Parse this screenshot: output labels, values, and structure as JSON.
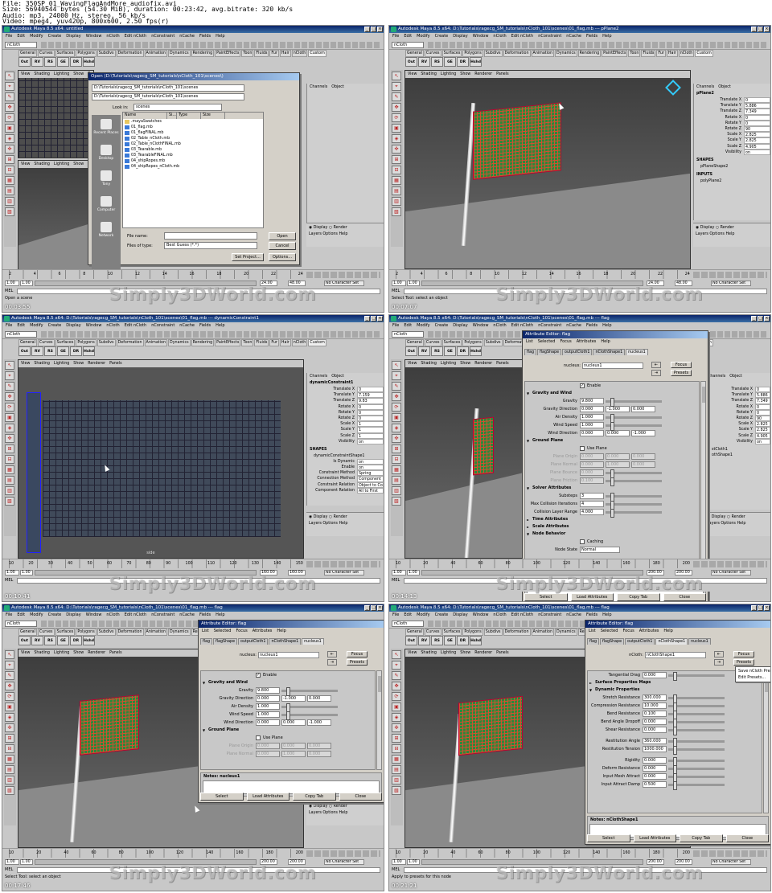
{
  "info": {
    "line1": "File: 350SP_01_WavingFlagAndMore_audiofix.avi",
    "line2": "Size: 56940544 bytes (54.30 MiB), duration: 00:23:42, avg.bitrate: 320 kb/s",
    "line3": "Audio: mp3, 24000 Hz, stereo, 56 kb/s",
    "line4": "Video: mpeg4, yuv420p, 800x600, 2.50 fps(r)"
  },
  "watermark": "Simply3DWorld.com",
  "common": {
    "menus": [
      "File",
      "Edit",
      "Modify",
      "Create",
      "Display",
      "Window",
      "nCloth",
      "Edit nCloth",
      "nConstraint",
      "nCache",
      "Fields",
      "Help"
    ],
    "mode": "nCloth",
    "shelf_tabs": [
      "General",
      "Curves",
      "Surfaces",
      "Polygons",
      "Subdivs",
      "Deformation",
      "Animation",
      "Dynamics",
      "Rendering",
      "PaintEffects",
      "Toon",
      "Fluids",
      "Fur",
      "Hair",
      "nCloth",
      "Custom"
    ],
    "shelf_icons": [
      "Out",
      "RV",
      "RS",
      "GE",
      "DR",
      "Hshd"
    ],
    "vp_menus": [
      "View",
      "Shading",
      "Lighting",
      "Show",
      "Renderer",
      "Panels"
    ],
    "mel": "MEL",
    "channel_head": [
      "Channels",
      "Object"
    ],
    "layer_radio": [
      "Display",
      "Render"
    ],
    "layer_menu": [
      "Layers",
      "Options",
      "Help"
    ],
    "no_char_set": "No Character Set",
    "tick_labels": [
      "2",
      "4",
      "6",
      "8",
      "10",
      "12",
      "14",
      "16",
      "18",
      "20",
      "22",
      "24"
    ],
    "tick_labels_long": [
      "10",
      "20",
      "30",
      "40",
      "50",
      "60",
      "70",
      "80",
      "90",
      "100",
      "110",
      "120",
      "130",
      "140",
      "150"
    ],
    "tick_labels_long2": [
      "10",
      "20",
      "40",
      "60",
      "80",
      "100",
      "120",
      "140",
      "160",
      "180",
      "200"
    ],
    "toolbox": [
      "↖",
      "⌖",
      "✎",
      "✥",
      "⟳",
      "▣",
      "◈",
      "✜",
      "⊞",
      "⊟",
      "▦",
      "▤",
      "▥",
      "▧"
    ]
  },
  "frames": {
    "f1": {
      "title": "Autodesk Maya 8.5 x64: untitled",
      "range_start": "1.00",
      "range_start2": "1.00",
      "range_end": "24.00",
      "range_end2": "48.00",
      "help": "Open a scene",
      "vp_label": "front",
      "dialog": {
        "title": "Open (D:\\Tutorials\\ragecg_SM_tutorials\\nCloth_101\\scenes\\)",
        "path1": "D:\\Tutorials\\ragecg_SM_tutorials\\nCloth_101\\scenes",
        "path2": "D:\\Tutorials\\ragecg_SM_tutorials\\nCloth_101\\scenes",
        "look_in_label": "Look in:",
        "look_in": "scenes",
        "cols": [
          "Name",
          "Si...",
          "Type",
          "Size"
        ],
        "files": [
          ".mayaSwatches",
          "01_flag.mb",
          "01_flagFINAL.mb",
          "02_Table_nCloth.mb",
          "02_Table_nClothFINAL.mb",
          "03_Tearable.mb",
          "03_TearableFINAL.mb",
          "04_shipRopes.mb",
          "04_shipRopes_nCloth.mb"
        ],
        "places": [
          "Recent Places",
          "Desktop",
          "Tony",
          "Computer",
          "Network"
        ],
        "file_name_label": "File name:",
        "files_type_label": "Files of type:",
        "files_type": "Best Guess (*.*)",
        "open": "Open",
        "cancel": "Cancel",
        "set_project": "Set Project...",
        "options": "Options..."
      }
    },
    "f2": {
      "title": "Autodesk Maya 8.5 x64: D:\\Tutorials\\ragecg_SM_tutorials\\nCloth_101\\scenes\\01_flag.mb --- pPlane2",
      "obj": "pPlane2",
      "channels": [
        {
          "k": "Translate X",
          "v": "0"
        },
        {
          "k": "Translate Y",
          "v": "5.886"
        },
        {
          "k": "Translate Z",
          "v": "7.349"
        },
        {
          "k": "Rotate X",
          "v": "0"
        },
        {
          "k": "Rotate Y",
          "v": "0"
        },
        {
          "k": "Rotate Z",
          "v": "90"
        },
        {
          "k": "Scale X",
          "v": "2.825"
        },
        {
          "k": "Scale Y",
          "v": "2.825"
        },
        {
          "k": "Scale Z",
          "v": "4.905"
        },
        {
          "k": "Visibility",
          "v": "on"
        }
      ],
      "shapes": "SHAPES",
      "shape": "pPlaneShape2",
      "inputs": "INPUTS",
      "input": "polyPlane2",
      "vp_label": "persp",
      "range_start": "1.00",
      "range_start2": "1.00",
      "range_end": "24.00",
      "range_end2": "48.00",
      "help": "Select Tool: select an object"
    },
    "f3": {
      "title": "Autodesk Maya 8.5 x64: D:\\Tutorials\\ragecg_SM_tutorials\\nCloth_101\\scenes\\01_flag.mb --- dynamicConstraint1",
      "obj": "dynamicConstraint1",
      "channels": [
        {
          "k": "Translate X",
          "v": "0"
        },
        {
          "k": "Translate Y",
          "v": "7.159"
        },
        {
          "k": "Translate Z",
          "v": "9.83"
        },
        {
          "k": "Rotate X",
          "v": "0"
        },
        {
          "k": "Rotate Y",
          "v": "0"
        },
        {
          "k": "Rotate Z",
          "v": "0"
        },
        {
          "k": "Scale X",
          "v": "1"
        },
        {
          "k": "Scale Y",
          "v": "1"
        },
        {
          "k": "Scale Z",
          "v": "1"
        },
        {
          "k": "Visibility",
          "v": "on"
        }
      ],
      "shapes": "SHAPES",
      "shape": "dynamicConstraintShape1",
      "shape_channels": [
        {
          "k": "Is Dynamic",
          "v": "on"
        },
        {
          "k": "Enable",
          "v": "on"
        },
        {
          "k": "Constraint Method",
          "v": "Spring"
        },
        {
          "k": "Connection Method",
          "v": "Component"
        },
        {
          "k": "Constraint Relation",
          "v": "Object to Co"
        },
        {
          "k": "Component Relation",
          "v": "All to First"
        }
      ],
      "vp_label": "side",
      "range_start": "1.00",
      "range_start2": "1.00",
      "range_end": "160.00",
      "range_end2": "160.00",
      "help": ""
    },
    "f4": {
      "title": "Autodesk Maya 8.5 x64: D:\\Tutorials\\ragecg_SM_tutorials\\nCloth_101\\scenes\\01_flag.mb --- flag",
      "ae": {
        "title": "Attribute Editor: flag",
        "menus": [
          "List",
          "Selected",
          "Focus",
          "Attributes",
          "Help"
        ],
        "tabs": [
          "flag",
          "flagShape",
          "outputCloth1",
          "nClothShape1",
          "nucleus1"
        ],
        "node_label": "nucleus:",
        "node": "nucleus1",
        "focus": "Focus",
        "presets": "Presets",
        "enable": "Enable",
        "gw": "Gravity and Wind",
        "gravity_k": "Gravity",
        "gravity": "9.800",
        "gdir_k": "Gravity Direction",
        "gdir": [
          "0.000",
          "-1.000",
          "0.000"
        ],
        "air_k": "Air Density",
        "air": "1.000",
        "wspeed_k": "Wind Speed",
        "wspeed": "1.000",
        "wdir_k": "Wind Direction",
        "wdir": [
          "0.000",
          "0.000",
          "-1.000"
        ],
        "gp": "Ground Plane",
        "use_plane": "Use Plane",
        "porigin_k": "Plane Origin",
        "porigin": [
          "0.000",
          "0.000",
          "0.000"
        ],
        "pnormal_k": "Plane Normal",
        "pnormal": [
          "0.000",
          "1.000",
          "0.000"
        ],
        "pbounce_k": "Plane Bounce",
        "pbounce": "0.000",
        "pfriction_k": "Plane Friction",
        "pfriction": "0.100",
        "sa": "Solver Attributes",
        "substeps_k": "Substeps",
        "substeps": "3",
        "maxcol_k": "Max Collision Iterations",
        "maxcol": "4",
        "collayer_k": "Collision Layer Range",
        "collayer": "4.000",
        "ta": "Time Attributes",
        "sca": "Scale Attributes",
        "nb": "Node Behavior",
        "caching": "Caching",
        "node_state_k": "Node State",
        "node_state": "Normal",
        "notes": "Notes:  nucleus1",
        "btns": [
          "Select",
          "Load Attributes",
          "Copy Tab",
          "Close"
        ]
      },
      "channels": [
        {
          "k": "Translate X",
          "v": "0"
        },
        {
          "k": "Translate Y",
          "v": "5.886"
        },
        {
          "k": "Translate Z",
          "v": "7.349"
        },
        {
          "k": "Rotate X",
          "v": "0"
        },
        {
          "k": "Rotate Y",
          "v": "0"
        },
        {
          "k": "Rotate Z",
          "v": "90"
        },
        {
          "k": "Scale X",
          "v": "2.825"
        },
        {
          "k": "Scale Y",
          "v": "2.825"
        },
        {
          "k": "Scale Z",
          "v": "4.905"
        },
        {
          "k": "Visibility",
          "v": "on"
        }
      ],
      "shape_a": "stCloth1",
      "shape_b": "othShape1",
      "vp_label": "persp",
      "range_start": "1.00",
      "range_start2": "1.00",
      "range_end": "200.00",
      "range_end2": "200.00",
      "help": ""
    },
    "f5": {
      "title": "Autodesk Maya 8.5 x64: D:\\Tutorials\\ragecg_SM_tutorials\\nCloth_101\\scenes\\01_flag.mb --- flag",
      "ae": {
        "title": "Attribute Editor: flag",
        "menus": [
          "List",
          "Selected",
          "Focus",
          "Attributes",
          "Help"
        ],
        "tabs": [
          "flag",
          "flagShape",
          "outputCloth1",
          "nClothShape1",
          "nucleus1"
        ],
        "node_label": "nucleus:",
        "node": "nucleus1",
        "focus": "Focus",
        "presets": "Presets",
        "enable": "Enable",
        "gw": "Gravity and Wind",
        "gravity_k": "Gravity",
        "gravity": "9.800",
        "gdir_k": "Gravity Direction",
        "gdir": [
          "0.000",
          "-1.000",
          "0.000"
        ],
        "air_k": "Air Density",
        "air": "1.000",
        "wspeed_k": "Wind Speed",
        "wspeed": "1.000",
        "wdir_k": "Wind Direction",
        "wdir": [
          "0.000",
          "0.000",
          "-1.000"
        ],
        "gp": "Ground Plane",
        "use_plane": "Use Plane",
        "porigin_k": "Plane Origin",
        "porigin": [
          "0.000",
          "0.000",
          "0.000"
        ],
        "pnormal_k": "Plane Normal",
        "pnormal": [
          "0.000",
          "1.000",
          "0.000"
        ],
        "notes": "Notes:  nucleus1",
        "btns": [
          "Select",
          "Load Attributes",
          "Copy Tab",
          "Close"
        ]
      },
      "vp_label": "persp",
      "range_start": "1.00",
      "range_start2": "1.00",
      "range_end": "200.00",
      "range_end2": "200.00",
      "help": "Select Tool: select an object"
    },
    "f6": {
      "title": "Autodesk Maya 8.5 x64: D:\\Tutorials\\ragecg_SM_tutorials\\nCloth_101\\scenes\\01_flag.mb --- flag",
      "ae": {
        "title": "Attribute Editor: flag",
        "menus": [
          "List",
          "Selected",
          "Focus",
          "Attributes",
          "Help"
        ],
        "tabs": [
          "flag",
          "flagShape",
          "outputCloth1",
          "nClothShape1",
          "nucleus1"
        ],
        "node_label": "nCloth:",
        "node": "nClothShape1",
        "focus": "Focus",
        "presets": "Presets",
        "popup": [
          "Save nCloth Preset...",
          "Edit Presets..."
        ],
        "drag_k": "Tangential Drag",
        "drag": "0.000",
        "spm": "Surface Properties Maps",
        "dp": "Dynamic Properties",
        "rows": [
          {
            "k": "Stretch Resistance",
            "v": "300.000"
          },
          {
            "k": "Compression Resistance",
            "v": "10.000"
          },
          {
            "k": "Bend Resistance",
            "v": "0.100"
          },
          {
            "k": "Bend Angle Dropoff",
            "v": "0.000"
          },
          {
            "k": "Shear Resistance",
            "v": "0.000"
          }
        ],
        "rows2": [
          {
            "k": "Restitution Angle",
            "v": "360.000"
          },
          {
            "k": "Restitution Tension",
            "v": "1000.000"
          }
        ],
        "rows3": [
          {
            "k": "Rigidity",
            "v": "0.000"
          },
          {
            "k": "Deform Resistance",
            "v": "0.000"
          },
          {
            "k": "Input Mesh Attract",
            "v": "0.000"
          },
          {
            "k": "Input Attract Damp",
            "v": "0.500"
          }
        ],
        "notes": "Notes:  nClothShape1",
        "btns": [
          "Select",
          "Load Attributes",
          "Copy Tab",
          "Close"
        ]
      },
      "vp_label": "persp",
      "range_start": "1.00",
      "range_start2": "1.00",
      "range_end": "200.00",
      "range_end2": "200.00",
      "help": "Apply to presets for this node"
    }
  },
  "timestamps": [
    "00:03:55",
    "00:07:07",
    "00:10:41",
    "00:14:13",
    "00:17:46",
    "00:21:21"
  ]
}
